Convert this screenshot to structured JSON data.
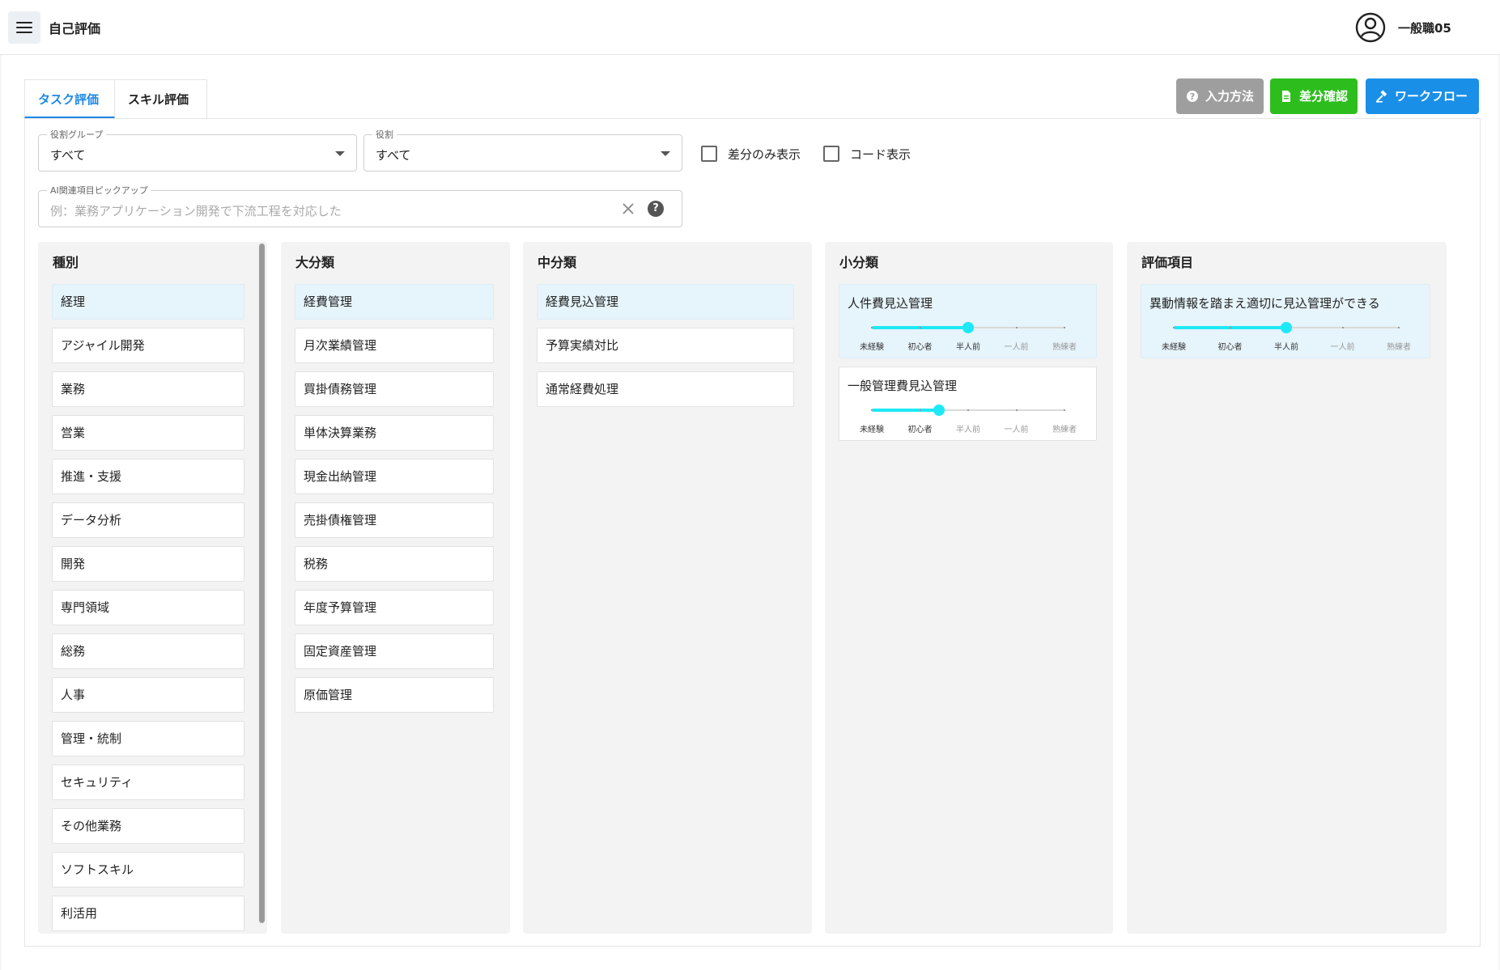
{
  "header": {
    "title": "自己評価",
    "user_name": "一般職05"
  },
  "tabs": [
    {
      "label": "タスク評価",
      "active": true
    },
    {
      "label": "スキル評価",
      "active": false
    }
  ],
  "actions": {
    "howto": "入力方法",
    "diff": "差分確認",
    "workflow": "ワークフロー"
  },
  "colors": {
    "accent": "#1e88e5",
    "howto_bg": "#9e9e9e",
    "diff_bg": "#2dbe1e",
    "workflow_bg": "#1a8fe8",
    "slider": "#1de9f6",
    "selected_bg": "#e6f4fb"
  },
  "filters": {
    "role_group": {
      "label": "役割グループ",
      "value": "すべて"
    },
    "role": {
      "label": "役割",
      "value": "すべて"
    },
    "diff_only": {
      "label": "差分のみ表示",
      "checked": false
    },
    "code_display": {
      "label": "コード表示",
      "checked": false
    },
    "ai_pickup": {
      "label": "AI関連項目ピックアップ",
      "placeholder": "例：業務アプリケーション開発で下流工程を対応した"
    }
  },
  "columns": {
    "type": {
      "title": "種別",
      "items": [
        "経理",
        "アジャイル開発",
        "業務",
        "営業",
        "推進・支援",
        "データ分析",
        "開発",
        "専門領域",
        "総務",
        "人事",
        "管理・統制",
        "セキュリティ",
        "その他業務",
        "ソフトスキル",
        "利活用"
      ],
      "selected": 0
    },
    "major": {
      "title": "大分類",
      "items": [
        "経費管理",
        "月次業績管理",
        "買掛債務管理",
        "単体決算業務",
        "現金出納管理",
        "売掛債権管理",
        "税務",
        "年度予算管理",
        "固定資産管理",
        "原価管理"
      ],
      "selected": 0
    },
    "middle": {
      "title": "中分類",
      "items": [
        "経費見込管理",
        "予算実績対比",
        "通常経費処理"
      ],
      "selected": 0
    },
    "minor": {
      "title": "小分類",
      "items": [
        {
          "name": "人件費見込管理",
          "level": 2,
          "selected": true
        },
        {
          "name": "一般管理費見込管理",
          "level": 1.4,
          "selected": false
        }
      ]
    },
    "evaluation": {
      "title": "評価項目",
      "items": [
        {
          "name": "異動情報を踏まえ適切に見込管理ができる",
          "level": 2,
          "selected": true
        }
      ]
    }
  },
  "levels": [
    "未経験",
    "初心者",
    "半人前",
    "一人前",
    "熟練者"
  ]
}
